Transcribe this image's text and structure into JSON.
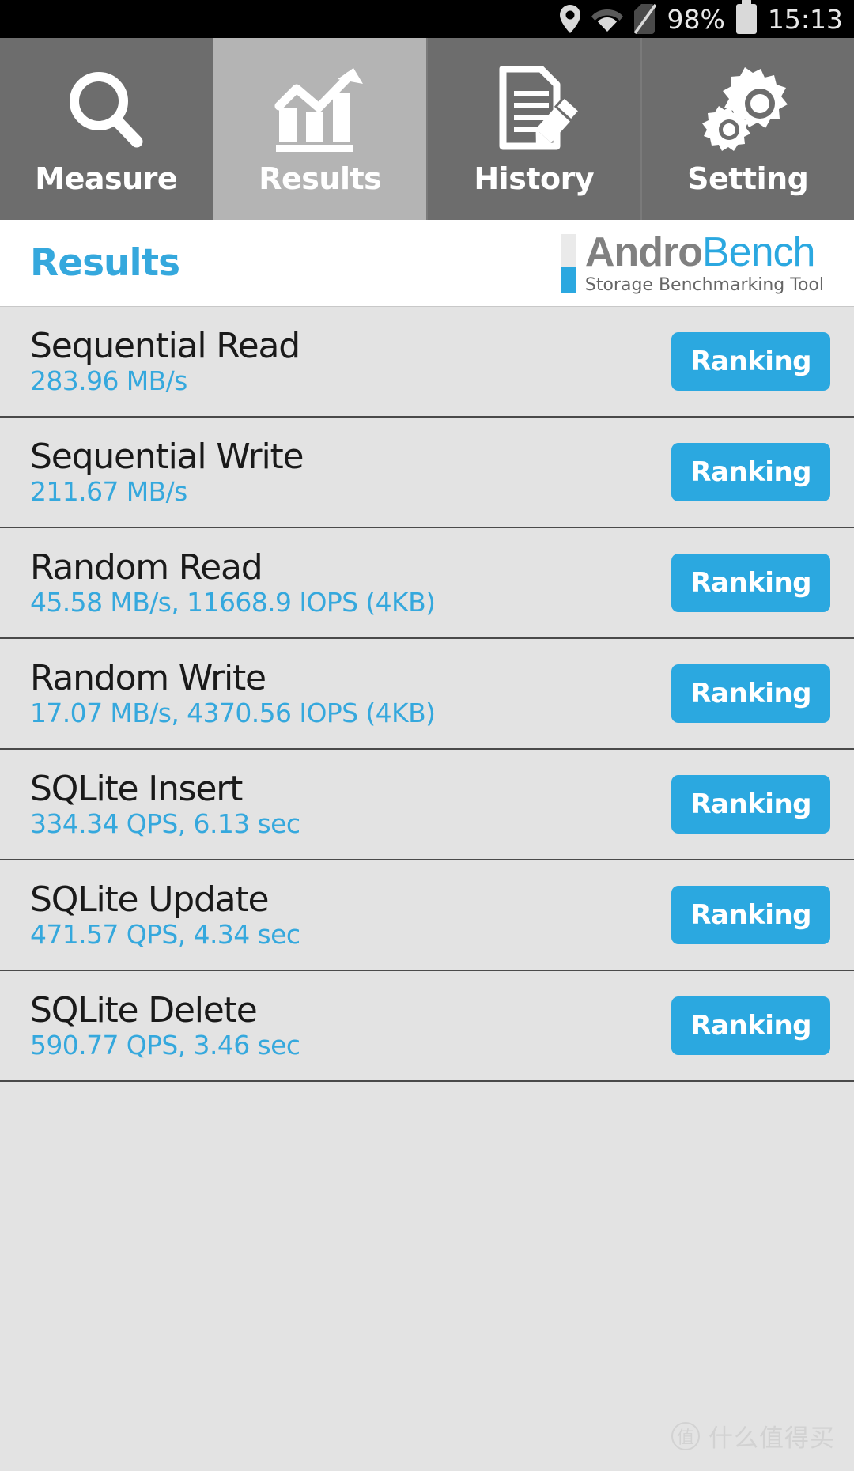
{
  "status_bar": {
    "battery_percent": "98%",
    "time": "15:13",
    "icons": [
      "location-icon",
      "wifi-icon",
      "sim-off-icon",
      "battery-icon"
    ]
  },
  "tabs": [
    {
      "label": "Measure",
      "icon": "magnifier-icon",
      "active": false
    },
    {
      "label": "Results",
      "icon": "bar-chart-arrow-icon",
      "active": true
    },
    {
      "label": "History",
      "icon": "document-pencil-icon",
      "active": false
    },
    {
      "label": "Setting",
      "icon": "gears-icon",
      "active": false
    }
  ],
  "header": {
    "title": "Results",
    "logo_primary": "Andro",
    "logo_secondary": "Bench",
    "logo_subtitle": "Storage Benchmarking Tool"
  },
  "colors": {
    "accent_blue": "#2ba8e0",
    "title_blue": "#35a8dd",
    "tab_inactive": "#6d6d6d",
    "tab_active": "#b4b4b4",
    "list_bg": "#e3e3e3",
    "logo_gray": "#808080"
  },
  "results": {
    "button_label": "Ranking",
    "rows": [
      {
        "name": "Sequential Read",
        "value": "283.96 MB/s"
      },
      {
        "name": "Sequential Write",
        "value": "211.67 MB/s"
      },
      {
        "name": "Random Read",
        "value": "45.58 MB/s, 11668.9 IOPS (4KB)"
      },
      {
        "name": "Random Write",
        "value": "17.07 MB/s, 4370.56 IOPS (4KB)"
      },
      {
        "name": "SQLite Insert",
        "value": "334.34 QPS, 6.13 sec"
      },
      {
        "name": "SQLite Update",
        "value": "471.57 QPS, 4.34 sec"
      },
      {
        "name": "SQLite Delete",
        "value": "590.77 QPS, 3.46 sec"
      }
    ]
  },
  "watermark": {
    "mark": "值",
    "text": "什么值得买"
  }
}
